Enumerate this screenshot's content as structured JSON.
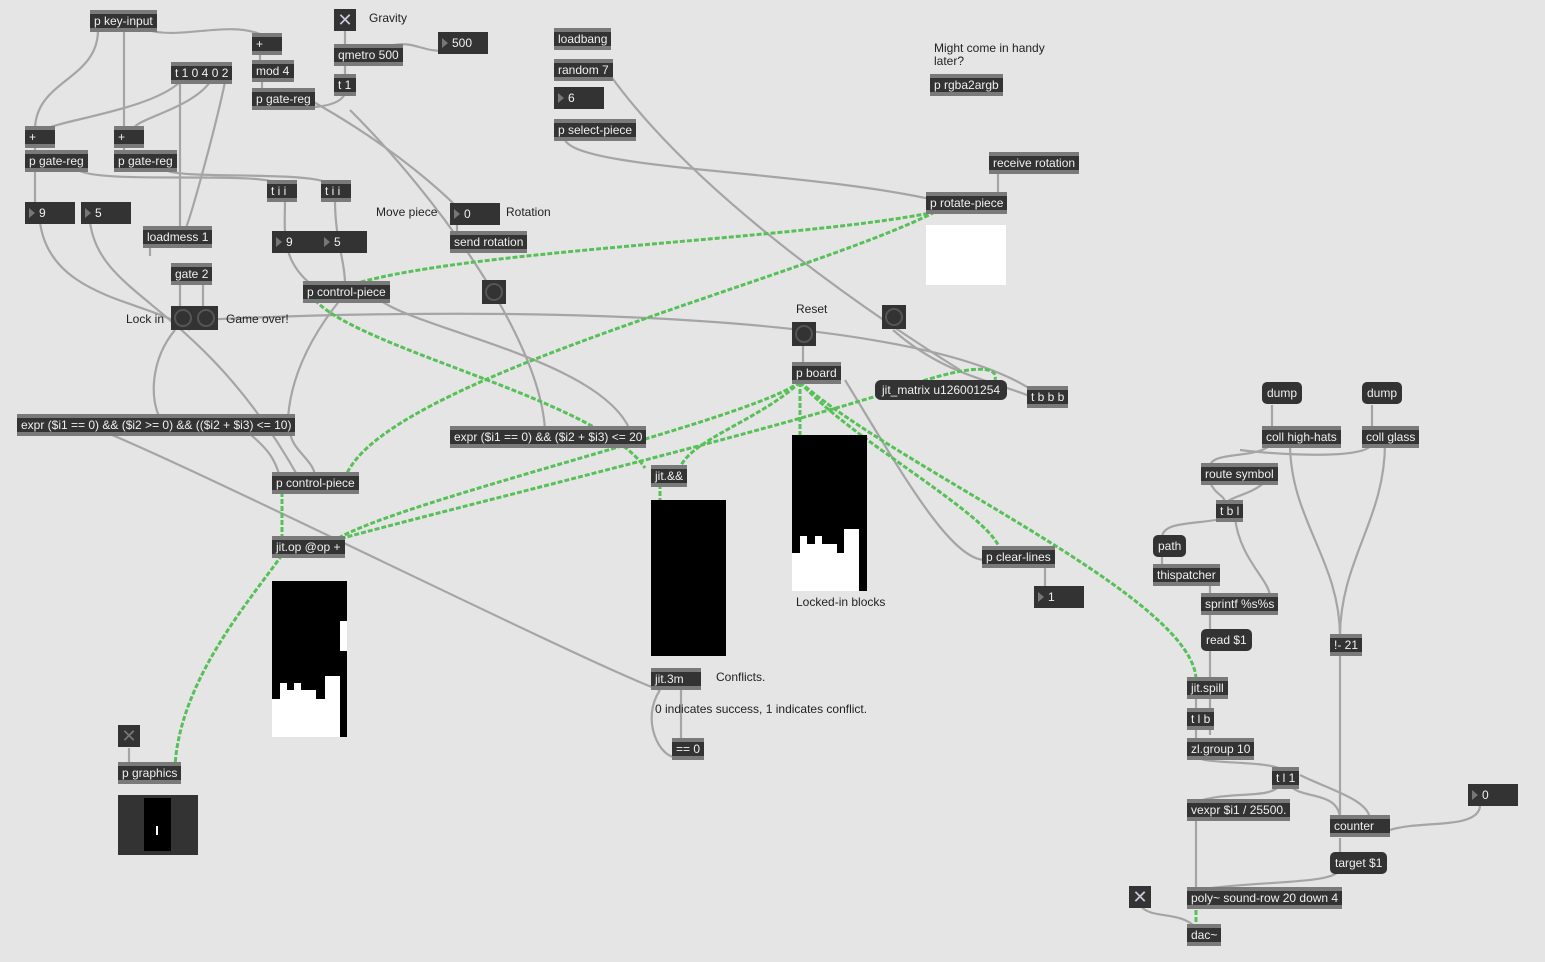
{
  "objects": {
    "key_input": "p key-input",
    "plus_top": "+",
    "mod4": "mod 4",
    "trigger_10402": "t 1 0 4 0 2",
    "gate_reg_top": "p gate-reg",
    "qmetro": "qmetro 500",
    "t1": "t 1",
    "plus_left": "+",
    "plus_mid": "+",
    "gate_reg_left": "p gate-reg",
    "gate_reg_mid": "p gate-reg",
    "tii_left": "t i i",
    "tii_right": "t i i",
    "loadmess": "loadmess 1",
    "gate2": "gate 2",
    "send_rotation": "send rotation",
    "control_piece_top": "p control-piece",
    "loadbang": "loadbang",
    "random7": "random 7",
    "select_piece": "p select-piece",
    "rgba2argb": "p rgba2argb",
    "receive_rotation": "receive rotation",
    "rotate_piece": "p rotate-piece",
    "p_board": "p board",
    "tbbb": "t b b b",
    "expr_long": "expr ($i1 == 0) && ($i2 >= 0) && (($i2 + $i3) <= 10)",
    "expr_short": "expr ($i1 == 0) && ($i2 + $i3) <= 20",
    "jit_and": "jit.&&",
    "control_piece_bottom": "p control-piece",
    "jit_op": "jit.op @op +",
    "clear_lines": "p clear-lines",
    "jit_3m": "jit.3m",
    "eq0": "== 0",
    "p_graphics": "p graphics",
    "coll_hihats": "coll high-hats",
    "coll_glass": "coll glass",
    "route_symbol": "route symbol",
    "tbl": "t b l",
    "thispatcher": "thispatcher",
    "sprintf": "sprintf %s%s",
    "minus21": "!- 21",
    "jit_spill": "jit.spill",
    "tlb": "t l b",
    "zlgroup": "zl.group 10",
    "tl1": "t l 1",
    "vexpr": "vexpr $i1 / 25500.",
    "counter": "counter",
    "poly": "poly~ sound-row 20 down 4",
    "dac": "dac~"
  },
  "messages": {
    "dump_hihats": "dump",
    "dump_glass": "dump",
    "path": "path",
    "read": "read $1",
    "target": "target $1"
  },
  "numbers": {
    "qmetro_interval": "500",
    "random_value": "6",
    "left_x": "9",
    "left_y": "5",
    "move_x": "9",
    "move_y": "5",
    "rotation": "0",
    "cleared_lines": "1",
    "counter_out": "0"
  },
  "comments": {
    "gravity": "Gravity",
    "might_come": "Might come in handy later?",
    "move_piece": "Move piece",
    "rotation": "Rotation",
    "lock_in": "Lock in",
    "game_over": "Game over!",
    "reset": "Reset",
    "locked_in_blocks": "Locked-in blocks",
    "conflicts": "Conflicts.",
    "conflict_note": "0 indicates success, 1 indicates conflict."
  },
  "hint": "jit_matrix u126001254",
  "toggles": {
    "gravity_on": true,
    "graphics_on": true,
    "audio_on": true
  },
  "icons": {
    "toggle": "x-toggle-icon",
    "bang": "bang-circle-icon"
  },
  "colors": {
    "canvas": "#e5e5e5",
    "object": "#333333",
    "patch_cord": "#a8a8a8",
    "matrix_cord": "#4fbf4f"
  }
}
